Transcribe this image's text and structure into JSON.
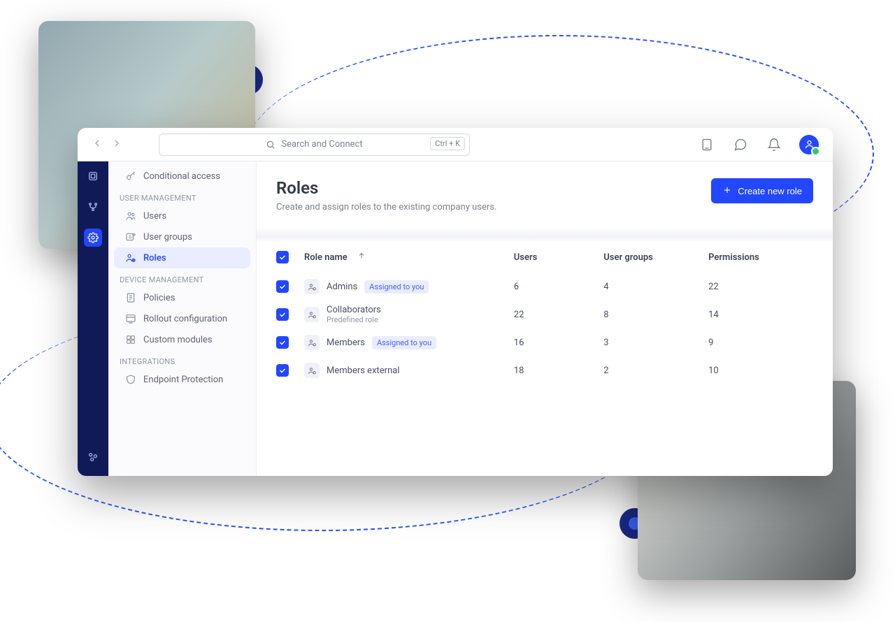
{
  "topbar": {
    "search_placeholder": "Search and Connect",
    "kbd": "Ctrl + K"
  },
  "sidebar": {
    "top_item": "Conditional access",
    "section_user": "USER MANAGEMENT",
    "users": "Users",
    "user_groups": "User groups",
    "roles": "Roles",
    "section_device": "DEVICE MANAGEMENT",
    "policies": "Policies",
    "rollout": "Rollout configuration",
    "custom": "Custom modules",
    "section_integrations": "INTEGRATIONS",
    "endpoint": "Endpoint Protection"
  },
  "header": {
    "title": "Roles",
    "subtitle": "Create and assign roles to the existing company users.",
    "button": "Create new role"
  },
  "table": {
    "head": {
      "role": "Role name",
      "users": "Users",
      "groups": "User groups",
      "perm": "Permissions"
    },
    "rows": [
      {
        "name": "Admins",
        "tag": "Assigned to you",
        "sub": "",
        "users": "6",
        "groups": "4",
        "perm": "22"
      },
      {
        "name": "Collaborators",
        "tag": "",
        "sub": "Predefined role",
        "users": "22",
        "groups": "8",
        "perm": "14"
      },
      {
        "name": "Members",
        "tag": "Assigned to you",
        "sub": "",
        "users": "16",
        "groups": "3",
        "perm": "9"
      },
      {
        "name": "Members external",
        "tag": "",
        "sub": "",
        "users": "18",
        "groups": "2",
        "perm": "10"
      }
    ]
  }
}
